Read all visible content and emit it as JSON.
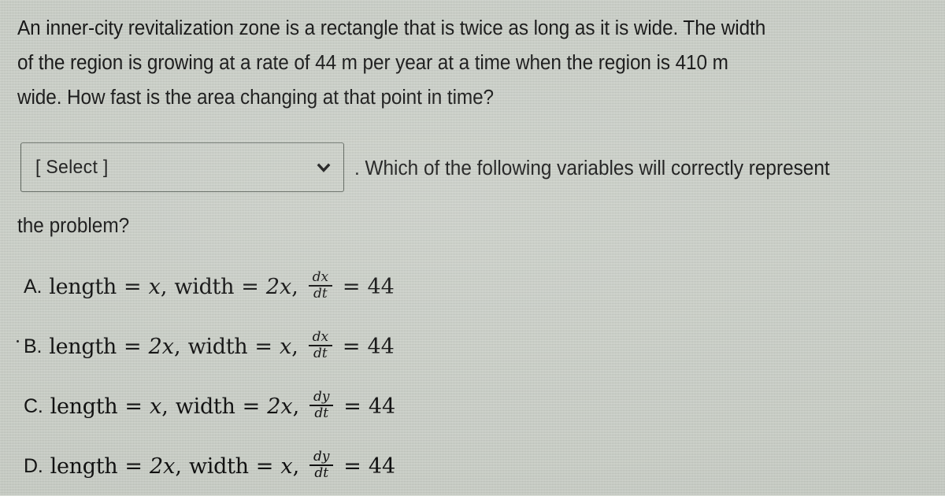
{
  "question": {
    "lines": [
      "An inner-city revitalization zone is a rectangle that is twice as long as it is wide. The width",
      "of the region is growing at a rate of 44 m per year at a time when the region is 410 m",
      "wide. How fast is the area changing at that point in time?"
    ],
    "tail_after_select": ". Which of the following variables will correctly represent",
    "tail_last_line": "the problem?"
  },
  "select": {
    "value": "[ Select ]",
    "chevron_icon": "chevron-down-icon"
  },
  "options": [
    {
      "letter": "A.",
      "length_word": "length",
      "length_value": "x",
      "width_word": "width",
      "width_value": "2x",
      "rate_num": "dx",
      "rate_den": "dt",
      "rate_value": "44",
      "predot": false
    },
    {
      "letter": "B.",
      "length_word": "length",
      "length_value": "2x",
      "width_word": "width",
      "width_value": "x",
      "rate_num": "dx",
      "rate_den": "dt",
      "rate_value": "44",
      "predot": true
    },
    {
      "letter": "C.",
      "length_word": "length",
      "length_value": "x",
      "width_word": "width",
      "width_value": "2x",
      "rate_num": "dy",
      "rate_den": "dt",
      "rate_value": "44",
      "predot": false
    },
    {
      "letter": "D.",
      "length_word": "length",
      "length_value": "2x",
      "width_word": "width",
      "width_value": "x",
      "rate_num": "dy",
      "rate_den": "dt",
      "rate_value": "44",
      "predot": false
    }
  ],
  "symbols": {
    "equals": "=",
    "comma": ","
  },
  "colors": {
    "background": "#d6dad3",
    "text": "#171717",
    "border": "#636b63"
  }
}
